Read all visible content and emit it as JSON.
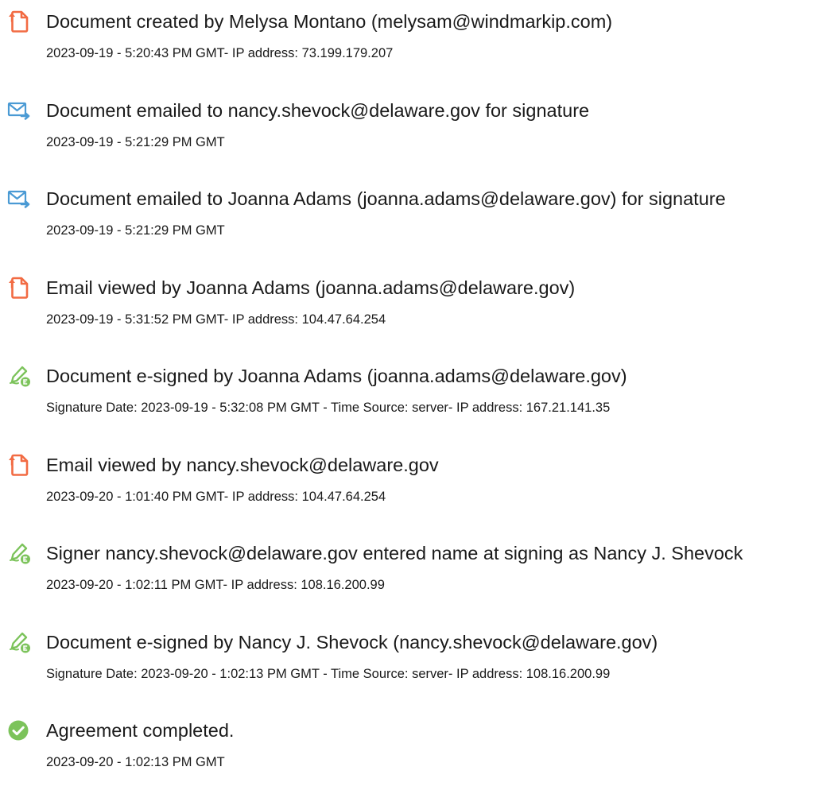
{
  "colors": {
    "created_icon": "#f26b43",
    "email_icon": "#4a9ad4",
    "signed_icon": "#7cc35b",
    "completed_icon": "#7cc35b",
    "text": "#1a1a1a"
  },
  "events": [
    {
      "icon": "document-created-icon",
      "title": "Document created by Melysa Montano (melysam@windmarkip.com)",
      "detail": "2023-09-19 - 5:20:43 PM GMT- IP address: 73.199.179.207"
    },
    {
      "icon": "email-sent-icon",
      "title": "Document emailed to nancy.shevock@delaware.gov for signature",
      "detail": "2023-09-19 - 5:21:29 PM GMT"
    },
    {
      "icon": "email-sent-icon",
      "title": "Document emailed to Joanna Adams (joanna.adams@delaware.gov) for signature",
      "detail": "2023-09-19 - 5:21:29 PM GMT"
    },
    {
      "icon": "email-viewed-icon",
      "title": "Email viewed by Joanna Adams (joanna.adams@delaware.gov)",
      "detail": "2023-09-19 - 5:31:52 PM GMT- IP address: 104.47.64.254"
    },
    {
      "icon": "e-sign-pen-icon",
      "title": "Document e-signed by Joanna Adams (joanna.adams@delaware.gov)",
      "detail": "Signature Date: 2023-09-19 - 5:32:08 PM GMT - Time Source: server- IP address: 167.21.141.35"
    },
    {
      "icon": "email-viewed-icon",
      "title": "Email viewed by nancy.shevock@delaware.gov",
      "detail": "2023-09-20 - 1:01:40 PM GMT- IP address: 104.47.64.254"
    },
    {
      "icon": "e-sign-pen-icon",
      "title": "Signer nancy.shevock@delaware.gov entered name at signing as Nancy J. Shevock",
      "detail": "2023-09-20 - 1:02:11 PM GMT- IP address: 108.16.200.99"
    },
    {
      "icon": "e-sign-pen-icon",
      "title": "Document e-signed by Nancy J. Shevock (nancy.shevock@delaware.gov)",
      "detail": "Signature Date: 2023-09-20 - 1:02:13 PM GMT - Time Source: server- IP address: 108.16.200.99"
    },
    {
      "icon": "check-circle-icon",
      "title": "Agreement completed.",
      "detail": "2023-09-20 - 1:02:13 PM GMT"
    }
  ]
}
